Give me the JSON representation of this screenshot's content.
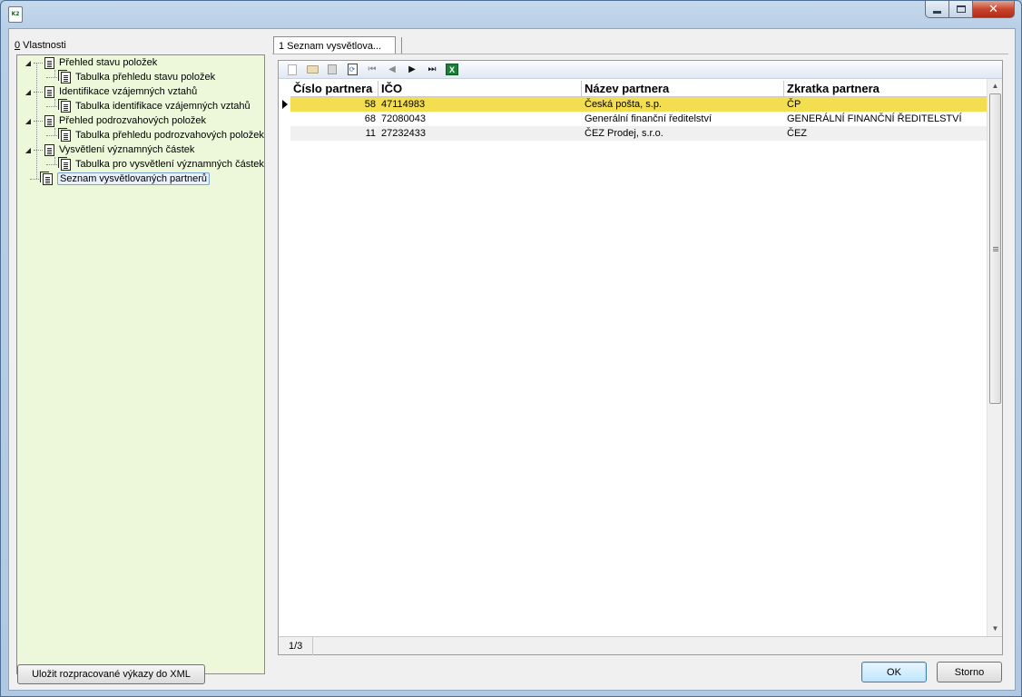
{
  "window": {
    "close_glyph": "✕",
    "app_icon_text": "K2"
  },
  "left_panel": {
    "label_mnemonic": "0",
    "label_rest": " Vlastnosti",
    "tree": [
      {
        "label": "Přehled stavu položek",
        "level": 0,
        "expanded": true,
        "icon": "document-icon"
      },
      {
        "label": "Tabulka přehledu stavu položek",
        "level": 1,
        "icon": "document-multi-icon"
      },
      {
        "label": "Identifikace vzájemných vztahů",
        "level": 0,
        "expanded": true,
        "icon": "document-icon"
      },
      {
        "label": "Tabulka identifikace vzájemných vztahů",
        "level": 1,
        "icon": "document-multi-icon"
      },
      {
        "label": "Přehled podrozvahových položek",
        "level": 0,
        "expanded": true,
        "icon": "document-icon"
      },
      {
        "label": "Tabulka přehledu podrozvahových položek",
        "level": 1,
        "icon": "document-multi-icon"
      },
      {
        "label": "Vysvětlení významných částek",
        "level": 0,
        "expanded": true,
        "icon": "document-icon"
      },
      {
        "label": "Tabulka pro vysvětlení významných částek",
        "level": 1,
        "icon": "document-multi-icon"
      },
      {
        "label": "Seznam vysvětlovaných partnerů",
        "level": 0,
        "selected": true,
        "icon": "document-multi-icon"
      }
    ],
    "save_button": "Uložit rozpracované výkazy do XML"
  },
  "tabs": [
    {
      "label": "1 Seznam vysvětlova..."
    }
  ],
  "toolbar": {
    "icons": [
      "new-record-icon",
      "open-icon",
      "delete-icon",
      "refresh-icon",
      "first-record-icon",
      "prev-record-icon",
      "next-record-icon",
      "last-record-icon",
      "excel-export-icon"
    ],
    "first_glyph": "⏮",
    "prev_glyph": "◀",
    "next_glyph": "▶",
    "last_glyph": "⏭",
    "excel_glyph": "X",
    "refresh_glyph": "⟳"
  },
  "grid": {
    "columns": [
      "Číslo partnera",
      "IČO",
      "Název partnera",
      "Zkratka partnera"
    ],
    "rows": [
      {
        "cislo": "58",
        "ico": "47114983",
        "nazev": "Česká pošta, s.p.",
        "zkratka": "ČP"
      },
      {
        "cislo": "68",
        "ico": "72080043",
        "nazev": "Generální finanční ředitelství",
        "zkratka": "GENERÁLNÍ FINANČNÍ ŘEDITELSTVÍ"
      },
      {
        "cislo": "11",
        "ico": "27232433",
        "nazev": "ČEZ Prodej, s.r.o.",
        "zkratka": "ČEZ"
      }
    ],
    "selected_row": 0,
    "scroll_up": "▲",
    "scroll_down": "▼"
  },
  "status": {
    "record_position": "1/3"
  },
  "buttons": {
    "ok": "OK",
    "cancel": "Storno"
  },
  "colors": {
    "selected_row": "#f2de4f",
    "tree_background": "#ecf8d9",
    "close_button": "#c7452f"
  }
}
